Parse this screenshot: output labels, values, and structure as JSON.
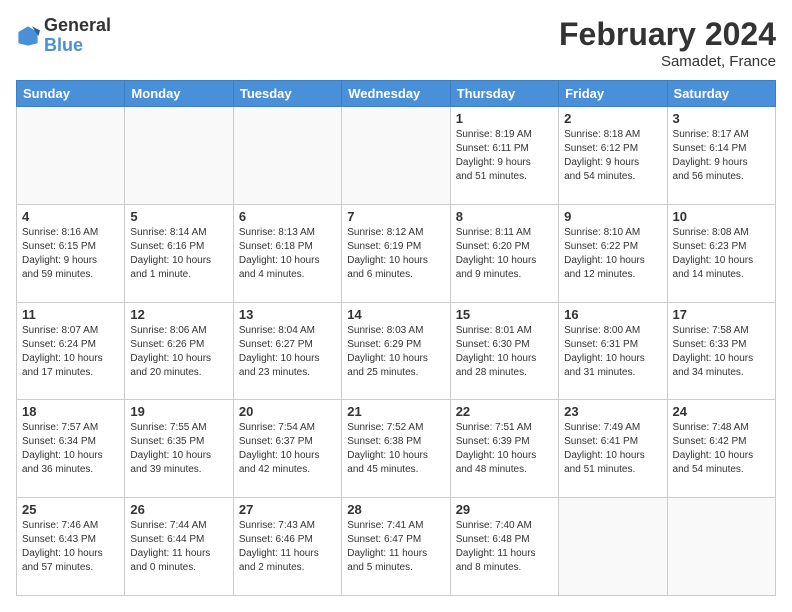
{
  "header": {
    "logo_general": "General",
    "logo_blue": "Blue",
    "month_year": "February 2024",
    "location": "Samadet, France"
  },
  "weekdays": [
    "Sunday",
    "Monday",
    "Tuesday",
    "Wednesday",
    "Thursday",
    "Friday",
    "Saturday"
  ],
  "weeks": [
    [
      {
        "day": "",
        "info": ""
      },
      {
        "day": "",
        "info": ""
      },
      {
        "day": "",
        "info": ""
      },
      {
        "day": "",
        "info": ""
      },
      {
        "day": "1",
        "info": "Sunrise: 8:19 AM\nSunset: 6:11 PM\nDaylight: 9 hours\nand 51 minutes."
      },
      {
        "day": "2",
        "info": "Sunrise: 8:18 AM\nSunset: 6:12 PM\nDaylight: 9 hours\nand 54 minutes."
      },
      {
        "day": "3",
        "info": "Sunrise: 8:17 AM\nSunset: 6:14 PM\nDaylight: 9 hours\nand 56 minutes."
      }
    ],
    [
      {
        "day": "4",
        "info": "Sunrise: 8:16 AM\nSunset: 6:15 PM\nDaylight: 9 hours\nand 59 minutes."
      },
      {
        "day": "5",
        "info": "Sunrise: 8:14 AM\nSunset: 6:16 PM\nDaylight: 10 hours\nand 1 minute."
      },
      {
        "day": "6",
        "info": "Sunrise: 8:13 AM\nSunset: 6:18 PM\nDaylight: 10 hours\nand 4 minutes."
      },
      {
        "day": "7",
        "info": "Sunrise: 8:12 AM\nSunset: 6:19 PM\nDaylight: 10 hours\nand 6 minutes."
      },
      {
        "day": "8",
        "info": "Sunrise: 8:11 AM\nSunset: 6:20 PM\nDaylight: 10 hours\nand 9 minutes."
      },
      {
        "day": "9",
        "info": "Sunrise: 8:10 AM\nSunset: 6:22 PM\nDaylight: 10 hours\nand 12 minutes."
      },
      {
        "day": "10",
        "info": "Sunrise: 8:08 AM\nSunset: 6:23 PM\nDaylight: 10 hours\nand 14 minutes."
      }
    ],
    [
      {
        "day": "11",
        "info": "Sunrise: 8:07 AM\nSunset: 6:24 PM\nDaylight: 10 hours\nand 17 minutes."
      },
      {
        "day": "12",
        "info": "Sunrise: 8:06 AM\nSunset: 6:26 PM\nDaylight: 10 hours\nand 20 minutes."
      },
      {
        "day": "13",
        "info": "Sunrise: 8:04 AM\nSunset: 6:27 PM\nDaylight: 10 hours\nand 23 minutes."
      },
      {
        "day": "14",
        "info": "Sunrise: 8:03 AM\nSunset: 6:29 PM\nDaylight: 10 hours\nand 25 minutes."
      },
      {
        "day": "15",
        "info": "Sunrise: 8:01 AM\nSunset: 6:30 PM\nDaylight: 10 hours\nand 28 minutes."
      },
      {
        "day": "16",
        "info": "Sunrise: 8:00 AM\nSunset: 6:31 PM\nDaylight: 10 hours\nand 31 minutes."
      },
      {
        "day": "17",
        "info": "Sunrise: 7:58 AM\nSunset: 6:33 PM\nDaylight: 10 hours\nand 34 minutes."
      }
    ],
    [
      {
        "day": "18",
        "info": "Sunrise: 7:57 AM\nSunset: 6:34 PM\nDaylight: 10 hours\nand 36 minutes."
      },
      {
        "day": "19",
        "info": "Sunrise: 7:55 AM\nSunset: 6:35 PM\nDaylight: 10 hours\nand 39 minutes."
      },
      {
        "day": "20",
        "info": "Sunrise: 7:54 AM\nSunset: 6:37 PM\nDaylight: 10 hours\nand 42 minutes."
      },
      {
        "day": "21",
        "info": "Sunrise: 7:52 AM\nSunset: 6:38 PM\nDaylight: 10 hours\nand 45 minutes."
      },
      {
        "day": "22",
        "info": "Sunrise: 7:51 AM\nSunset: 6:39 PM\nDaylight: 10 hours\nand 48 minutes."
      },
      {
        "day": "23",
        "info": "Sunrise: 7:49 AM\nSunset: 6:41 PM\nDaylight: 10 hours\nand 51 minutes."
      },
      {
        "day": "24",
        "info": "Sunrise: 7:48 AM\nSunset: 6:42 PM\nDaylight: 10 hours\nand 54 minutes."
      }
    ],
    [
      {
        "day": "25",
        "info": "Sunrise: 7:46 AM\nSunset: 6:43 PM\nDaylight: 10 hours\nand 57 minutes."
      },
      {
        "day": "26",
        "info": "Sunrise: 7:44 AM\nSunset: 6:44 PM\nDaylight: 11 hours\nand 0 minutes."
      },
      {
        "day": "27",
        "info": "Sunrise: 7:43 AM\nSunset: 6:46 PM\nDaylight: 11 hours\nand 2 minutes."
      },
      {
        "day": "28",
        "info": "Sunrise: 7:41 AM\nSunset: 6:47 PM\nDaylight: 11 hours\nand 5 minutes."
      },
      {
        "day": "29",
        "info": "Sunrise: 7:40 AM\nSunset: 6:48 PM\nDaylight: 11 hours\nand 8 minutes."
      },
      {
        "day": "",
        "info": ""
      },
      {
        "day": "",
        "info": ""
      }
    ]
  ]
}
